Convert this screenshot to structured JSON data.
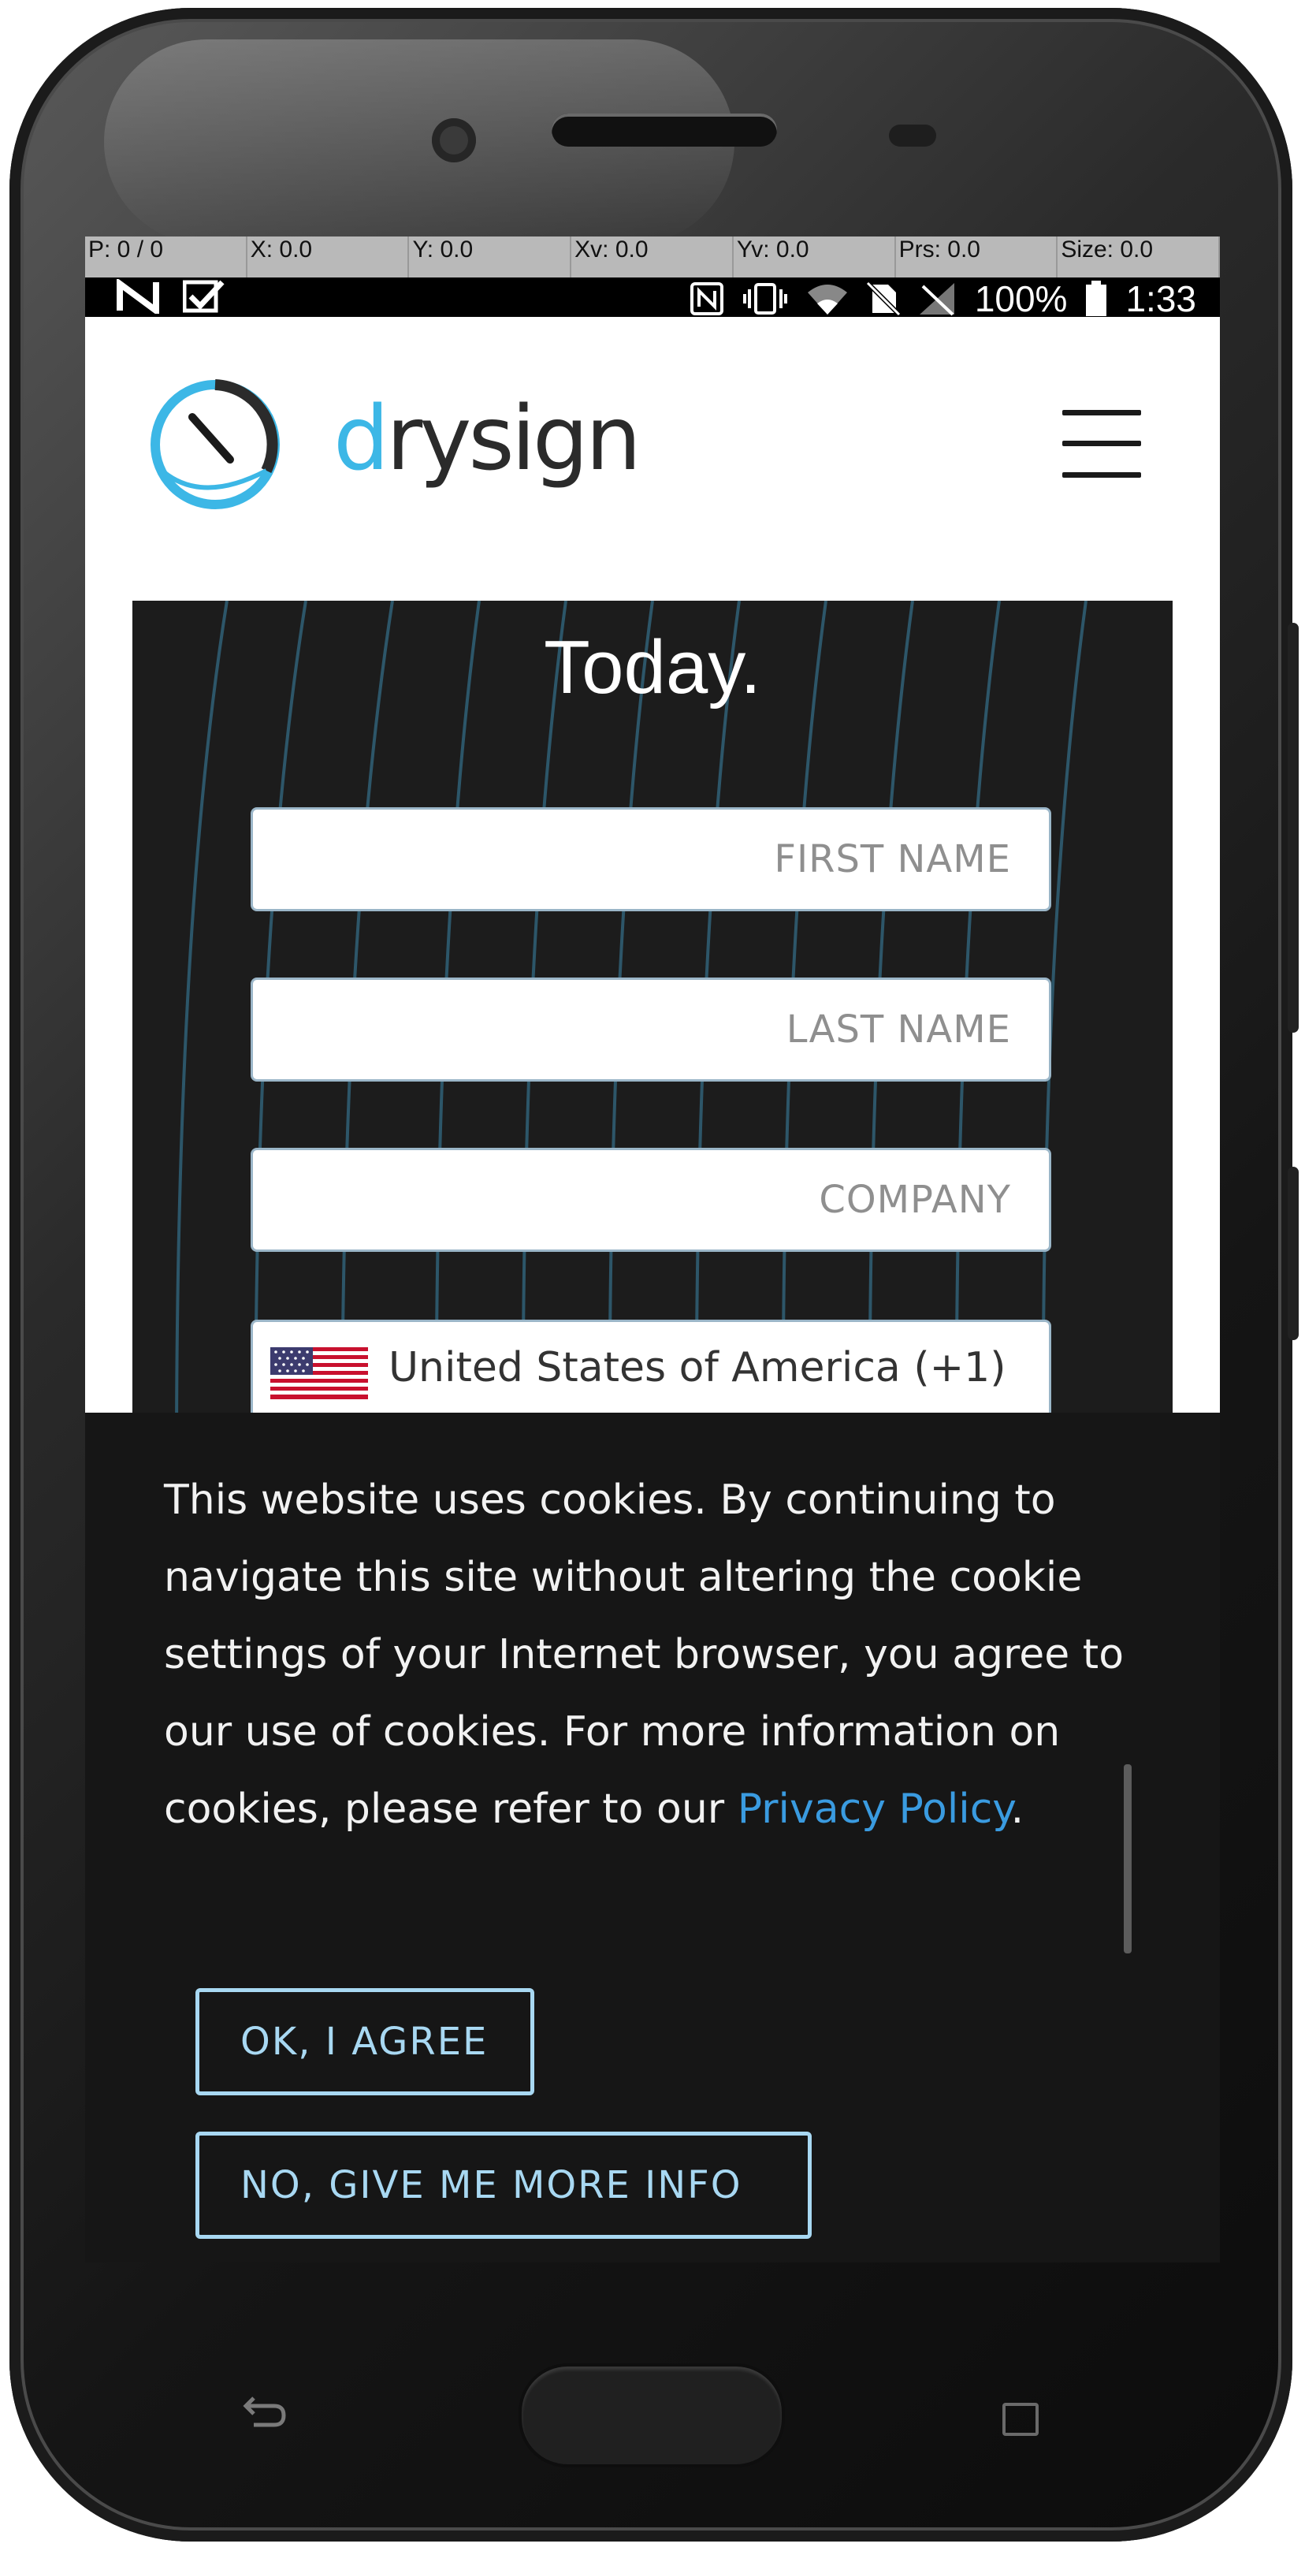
{
  "debug_bar": {
    "p": "P: 0 / 0",
    "x": "X: 0.0",
    "y": "Y: 0.0",
    "xv": "Xv: 0.0",
    "yv": "Yv: 0.0",
    "prs": "Prs: 0.0",
    "size": "Size: 0.0"
  },
  "status_bar": {
    "battery": "100%",
    "time": "1:33",
    "left_icons": [
      "n-icon",
      "checkmark-icon"
    ],
    "right_icons": [
      "nfc-icon",
      "vibrate-icon",
      "wifi-icon",
      "no-sim-icon",
      "no-signal-icon",
      "battery-icon"
    ]
  },
  "header": {
    "logo_d": "d",
    "logo_rest": "rysign",
    "menu_icon": "hamburger-icon"
  },
  "form": {
    "title": "Today.",
    "first_name_placeholder": "FIRST NAME",
    "last_name_placeholder": "LAST NAME",
    "company_placeholder": "COMPANY",
    "country_value": "United States of America (+1)",
    "flag_icon": "us-flag-icon"
  },
  "cookie_banner": {
    "text": "This website uses cookies. By continuing to navigate this site without altering the cookie settings of your Internet browser, you agree to our use of cookies. For more information on cookies, please refer to our ",
    "link_text": "Privacy Policy",
    "suffix": ".",
    "agree_button": "OK, I AGREE",
    "info_button": "NO, GIVE ME MORE INFO"
  },
  "colors": {
    "brand_blue": "#3cb7e6",
    "button_outline": "#a8d8f2",
    "link": "#3a9be0",
    "panel_bg": "#1c1c1c",
    "banner_bg": "#161616"
  }
}
